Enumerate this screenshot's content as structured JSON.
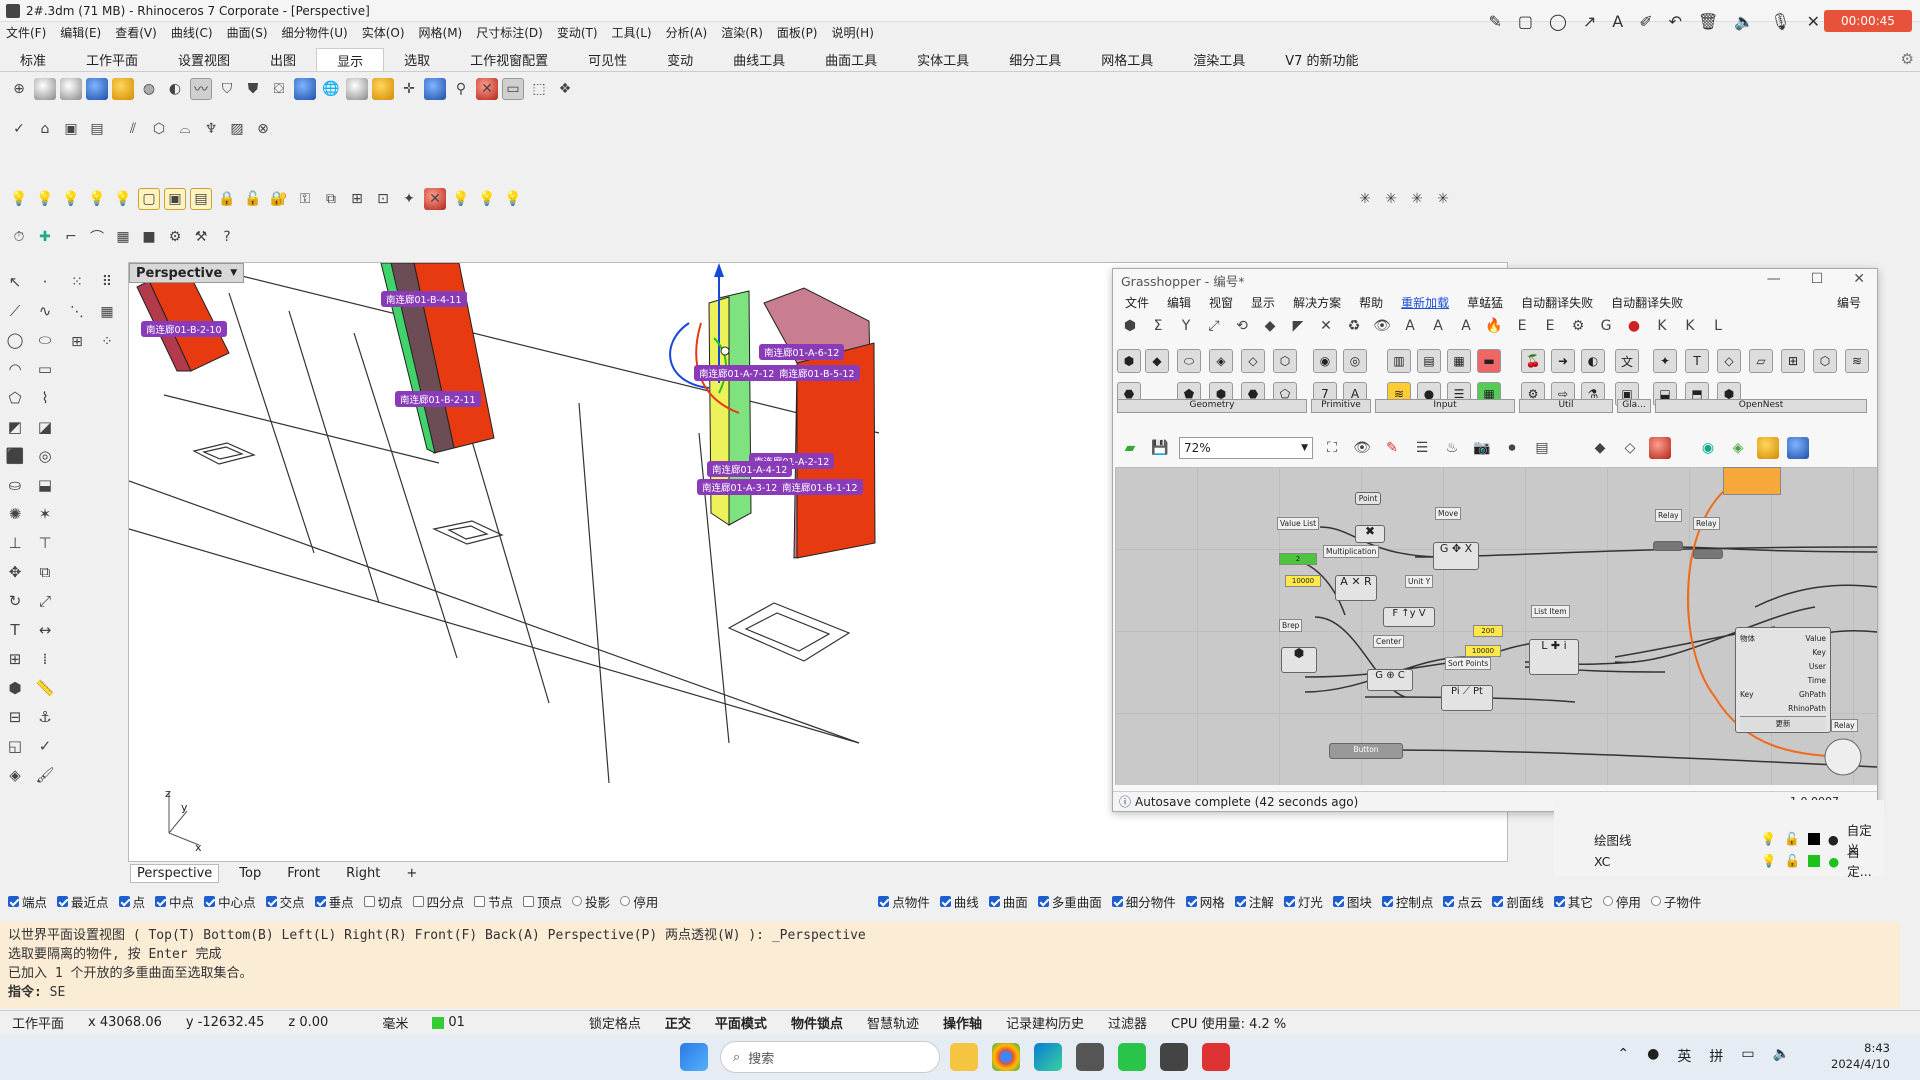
{
  "window": {
    "title": "2#.3dm (71 MB) - Rhinoceros 7 Corporate - [Perspective]",
    "rec_time": "00:00:45"
  },
  "menu": [
    "文件(F)",
    "编辑(E)",
    "查看(V)",
    "曲线(C)",
    "曲面(S)",
    "细分物件(U)",
    "实体(O)",
    "网格(M)",
    "尺寸标注(D)",
    "变动(T)",
    "工具(L)",
    "分析(A)",
    "渲染(R)",
    "面板(P)",
    "说明(H)"
  ],
  "tabs": [
    "标准",
    "工作平面",
    "设置视图",
    "出图",
    "显示",
    "选取",
    "工作视窗配置",
    "可见性",
    "变动",
    "曲线工具",
    "曲面工具",
    "实体工具",
    "细分工具",
    "网格工具",
    "渲染工具",
    "V7 的新功能"
  ],
  "active_tab": "显示",
  "viewport": {
    "label": "Perspective",
    "axis_z": "z",
    "axis_y": "y",
    "axis_x": "x",
    "tags": [
      "南连廊01-B-2-10",
      "南连廊01-B-4-11",
      "南连廊01-B-2-11",
      "南连廊01-A-6-12",
      "南连廊01-A-7-12",
      "南连廊01-B-5-12",
      "南连廊01-A-2-12",
      "南连廊01-A-4-12",
      "南连廊01-A-3-12",
      "南连廊01-B-1-12"
    ]
  },
  "view_tabs": [
    "Perspective",
    "Top",
    "Front",
    "Right",
    "+"
  ],
  "osnap": [
    {
      "label": "端点",
      "on": true
    },
    {
      "label": "最近点",
      "on": true
    },
    {
      "label": "点",
      "on": true
    },
    {
      "label": "中点",
      "on": true
    },
    {
      "label": "中心点",
      "on": true
    },
    {
      "label": "交点",
      "on": true
    },
    {
      "label": "垂点",
      "on": true
    },
    {
      "label": "切点",
      "on": false
    },
    {
      "label": "四分点",
      "on": false
    },
    {
      "label": "节点",
      "on": false
    },
    {
      "label": "顶点",
      "on": false
    },
    {
      "label": "投影",
      "radio": true
    },
    {
      "label": "停用",
      "radio": true
    }
  ],
  "filters": [
    {
      "label": "点物件",
      "on": true
    },
    {
      "label": "曲线",
      "on": true
    },
    {
      "label": "曲面",
      "on": true
    },
    {
      "label": "多重曲面",
      "on": true
    },
    {
      "label": "细分物件",
      "on": true
    },
    {
      "label": "网格",
      "on": true
    },
    {
      "label": "注解",
      "on": true
    },
    {
      "label": "灯光",
      "on": true
    },
    {
      "label": "图块",
      "on": true
    },
    {
      "label": "控制点",
      "on": true
    },
    {
      "label": "点云",
      "on": true
    },
    {
      "label": "剖面线",
      "on": true
    },
    {
      "label": "其它",
      "on": true
    },
    {
      "label": "停用",
      "radio": true
    },
    {
      "label": "子物件",
      "radio": true
    }
  ],
  "command": {
    "line1": "以世界平面设置视图 ( Top(T)  Bottom(B)  Left(L)  Right(R)  Front(F)  Back(A)  Perspective(P)  两点透视(W) ): _Perspective",
    "line2": "选取要隔离的物件, 按 Enter 完成",
    "line3": "已加入 1 个开放的多重曲面至选取集合。",
    "prompt": "指令:",
    "input": "SE"
  },
  "status": {
    "plane": "工作平面",
    "x": "x 43068.06",
    "y": "y -12632.45",
    "z": "z 0.00",
    "unit": "毫米",
    "layer": "01",
    "items": [
      "锁定格点",
      "正交",
      "平面模式",
      "物件锁点",
      "智慧轨迹",
      "操作轴",
      "记录建构历史",
      "过滤器"
    ],
    "bold_items": [
      "正交",
      "平面模式",
      "物件锁点",
      "操作轴"
    ],
    "cpu": "CPU 使用量: 4.2 %"
  },
  "taskbar": {
    "search": "搜索",
    "time": "8:43",
    "date": "2024/4/10",
    "ime1": "英",
    "ime2": "拼"
  },
  "grasshopper": {
    "title": "Grasshopper - 编号*",
    "menu": [
      "文件",
      "编辑",
      "视窗",
      "显示",
      "解决方案",
      "帮助",
      "重新加载",
      "草蜢猛",
      "自动翻译失败",
      "自动翻译失败",
      "编号"
    ],
    "menu_selected": "重新加载",
    "groups": [
      "Geometry",
      "Primitive",
      "Input",
      "Util",
      "Gla...",
      "OpenNest"
    ],
    "zoom": "72%",
    "nodes": {
      "point": "Point",
      "move": "Move",
      "value_list": "Value List",
      "multiplication": "Multiplication",
      "unit_y": "Unit Y",
      "brep": "Brep",
      "center": "Center",
      "sort_points": "Sort Points",
      "list_item": "List Item",
      "relay1": "Relay",
      "relay2": "Relay",
      "relay3": "Relay",
      "button": "Button",
      "value": "Value",
      "key": "Key",
      "user": "User",
      "time": "Time",
      "ghpath": "GhPath",
      "rhinopath": "RhinoPath",
      "obj": "物体",
      "key2": "Key",
      "update": "更新",
      "num1": "10000",
      "num2": "200",
      "num3": "10000",
      "num4": "2"
    },
    "status": "Autosave complete (42 seconds ago)",
    "version": "1.0.0007"
  },
  "layers": [
    {
      "name": "绘图线",
      "mat": "自定义",
      "color": "#000000"
    },
    {
      "name": "XC",
      "mat": "自定...",
      "color": "#1ec21e"
    }
  ]
}
